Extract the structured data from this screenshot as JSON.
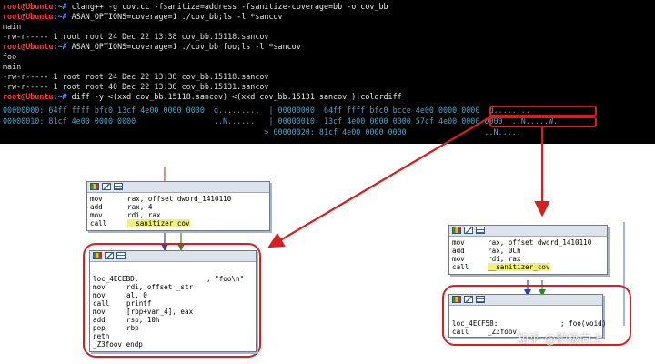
{
  "terminal": {
    "lines": [
      {
        "prompt": "root@Ubuntu",
        "path": ":~#",
        "cmd": " clang++ -g cov.cc -fsanitize=address -fsanitize-coverage=bb -o cov_bb"
      },
      {
        "prompt": "root@Ubuntu",
        "path": ":~#",
        "cmd": " ASAN_OPTIONS=coverage=1 ./cov_bb;ls -l *sancov"
      },
      {
        "text": "main"
      },
      {
        "text": "-rw-r----- 1 root root 24 Dec 22 13:38 cov_bb.15118.sancov"
      },
      {
        "prompt": "root@Ubuntu",
        "path": ":~#",
        "cmd": " ASAN_OPTIONS=coverage=1 ./cov_bb foo;ls -l *sancov"
      },
      {
        "text": "foo"
      },
      {
        "text": "main"
      },
      {
        "text": "-rw-r----- 1 root root 24 Dec 22 13:38 cov_bb.15118.sancov"
      },
      {
        "text": "-rw-r----- 1 root root 40 Dec 22 13:38 cov_bb.15131.sancov"
      },
      {
        "prompt": "root@Ubuntu",
        "path": ":~#",
        "cmd": " diff -y <(xxd cov_bb.15118.sancov) <(xxd cov_bb.15131.sancov )|colordiff"
      },
      {
        "text": "00000000: 64ff ffff bfc0 13cf 4e00 0000 0000  d.........  | 00000000: 64ff ffff bfc0 bcce 4e00 0000 0000  d........",
        "diff": true
      },
      {
        "text": "00000010: 81cf 4e00 0000 0000                 ..N......   | 00000010: 13cf 4e00 0000 0000 57cf 4e00 0000 0000  ..N.....W.",
        "diff": true
      },
      {
        "text": "                                                         > 00000020: 81cf 4e00 0000 0000                 ..N.....",
        "diff": true
      }
    ]
  },
  "left_graph": {
    "top_block": [
      {
        "op": "mov",
        "args": "rax, offset dword_1410110"
      },
      {
        "op": "add",
        "args": "rax, 4"
      },
      {
        "op": "mov",
        "args": "rdi, rax"
      },
      {
        "op": "call",
        "args": "__sanitizer_cov"
      }
    ],
    "bottom_block": {
      "label": "loc_4ECEBD:",
      "comment": "; \"foo\\n\"",
      "lines": [
        {
          "op": "mov",
          "args": "rdi, offset _str"
        },
        {
          "op": "mov",
          "args": "al, 0"
        },
        {
          "op": "call",
          "args": "printf"
        },
        {
          "op": "mov",
          "args": "[rbp+var_4], eax"
        },
        {
          "op": "add",
          "args": "rsp, 10h"
        },
        {
          "op": "pop",
          "args": "rbp"
        },
        {
          "op": "retn",
          "args": ""
        }
      ],
      "endp": "_Z3foov endp"
    }
  },
  "right_graph": {
    "top_block": [
      {
        "op": "mov",
        "args": "rax, offset dword_1410110"
      },
      {
        "op": "add",
        "args": "rax, 0Ch"
      },
      {
        "op": "mov",
        "args": "rdi, rax"
      },
      {
        "op": "call",
        "args": "__sanitizer_cov"
      }
    ],
    "bottom_block": {
      "label": "loc_4ECF58:",
      "comment": "; foo(void)",
      "call_op": "call",
      "call_args": "_Z3foov"
    }
  },
  "watermark": "知乎 @积极向上",
  "colors": {
    "prompt": "#ff3b3b",
    "path": "#6a8cff",
    "diff": "#4aa3c7",
    "highlight_box": "#d81e1e",
    "arrow": "#d81e1e",
    "sanitizer_highlight": "#f3f07a"
  },
  "icons": [
    "graph-view-icon",
    "edit-icon",
    "list-view-icon"
  ]
}
